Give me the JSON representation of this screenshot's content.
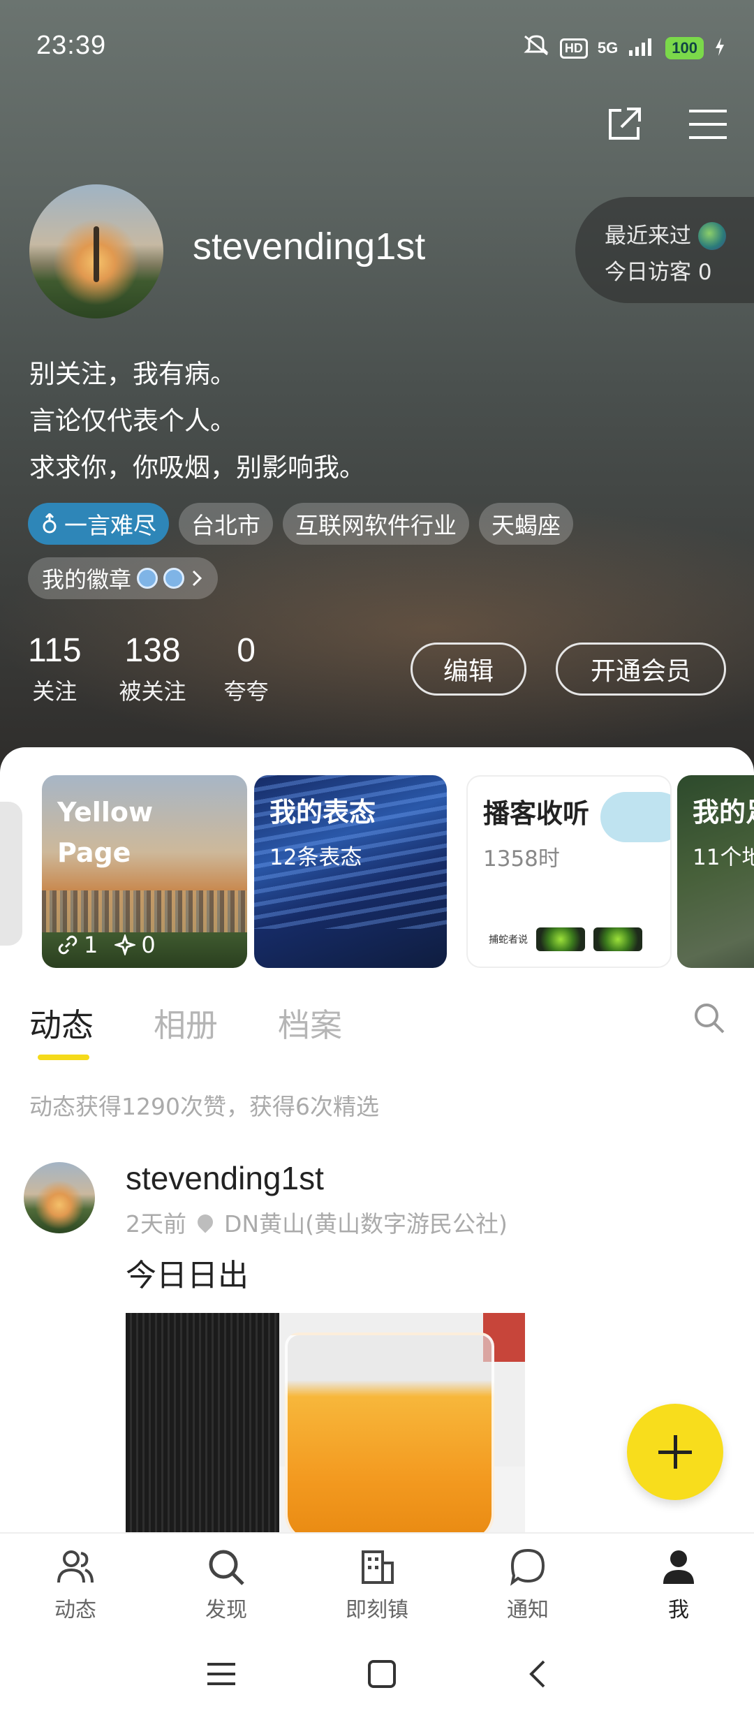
{
  "status": {
    "time": "23:39",
    "hd": "HD",
    "network": "5G",
    "battery": "100"
  },
  "profile": {
    "username": "stevending1st",
    "bio": [
      "别关注，我有病。",
      "言论仅代表个人。",
      "求求你，你吸烟，别影响我。"
    ],
    "tags": [
      "一言难尽",
      "台北市",
      "互联网软件行业",
      "天蝎座"
    ],
    "badge_label": "我的徽章",
    "visitor": {
      "recent": "最近来过",
      "today": "今日访客 0"
    },
    "stats": [
      {
        "value": "115",
        "label": "关注"
      },
      {
        "value": "138",
        "label": "被关注"
      },
      {
        "value": "0",
        "label": "夸夸"
      }
    ],
    "edit_label": "编辑",
    "vip_label": "开通会员"
  },
  "cards": [
    {
      "title": "Yellow\nPage",
      "links": "1",
      "stars": "0"
    },
    {
      "title": "我的表态",
      "sub": "12条表态"
    },
    {
      "title": "播客收听",
      "sub": "1358时",
      "logo": "捕蛇者说"
    },
    {
      "title": "我的足",
      "sub": "11个地"
    }
  ],
  "tabs": [
    "动态",
    "相册",
    "档案"
  ],
  "likes_summary": "动态获得1290次赞，获得6次精选",
  "post": {
    "username": "stevending1st",
    "time": "2天前",
    "location": "DN黄山(黄山数字游民公社)",
    "text": "今日日出"
  },
  "nav": [
    "动态",
    "发现",
    "即刻镇",
    "通知",
    "我"
  ],
  "colors": {
    "accent": "#f8dd1c",
    "tag_highlight": "#2e86b8"
  }
}
